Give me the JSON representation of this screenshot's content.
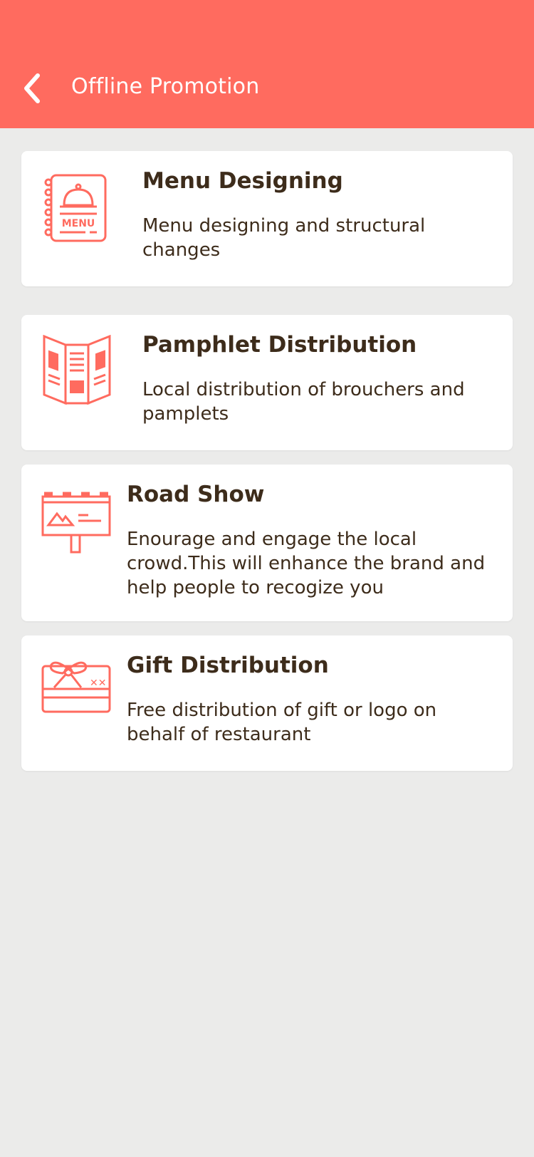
{
  "header": {
    "title": "Offline Promotion",
    "back_icon": "chevron-left-icon",
    "color": "#ff6b5f"
  },
  "services": [
    {
      "title": "Menu Designing",
      "description": "Menu designing and structural changes",
      "icon": "menu-book-icon"
    },
    {
      "title": "Pamphlet Distribution",
      "description": "Local distribution of brouchers and pamplets",
      "icon": "pamphlet-icon"
    },
    {
      "title": "Road Show",
      "description": "Enourage and engage the local crowd.This will enhance the brand and help people to  recogize you",
      "icon": "billboard-icon"
    },
    {
      "title": "Gift Distribution",
      "description": "Free distribution of gift or logo on behalf of restaurant",
      "icon": "gift-card-icon"
    }
  ],
  "colors": {
    "accent": "#ff6b5f",
    "text": "#3d2c1b",
    "background": "#ebebea",
    "card": "#ffffff"
  }
}
